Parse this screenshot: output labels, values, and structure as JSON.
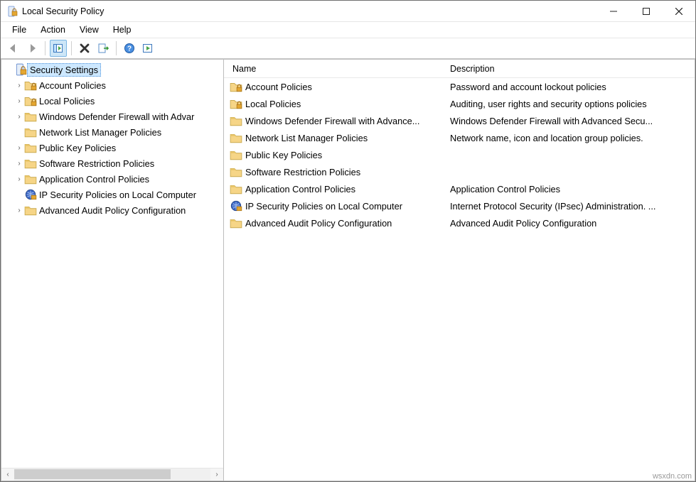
{
  "window": {
    "title": "Local Security Policy"
  },
  "menu": {
    "file": "File",
    "action": "Action",
    "view": "View",
    "help": "Help"
  },
  "tree": {
    "root": "Security Settings",
    "items": [
      {
        "label": "Account Policies",
        "icon": "folder-lock",
        "expandable": true
      },
      {
        "label": "Local Policies",
        "icon": "folder-lock",
        "expandable": true
      },
      {
        "label": "Windows Defender Firewall with Advar",
        "icon": "folder",
        "expandable": true
      },
      {
        "label": "Network List Manager Policies",
        "icon": "folder",
        "expandable": false
      },
      {
        "label": "Public Key Policies",
        "icon": "folder",
        "expandable": true
      },
      {
        "label": "Software Restriction Policies",
        "icon": "folder",
        "expandable": true
      },
      {
        "label": "Application Control Policies",
        "icon": "folder",
        "expandable": true
      },
      {
        "label": "IP Security Policies on Local Computer",
        "icon": "ipsec",
        "expandable": false
      },
      {
        "label": "Advanced Audit Policy Configuration",
        "icon": "folder",
        "expandable": true
      }
    ]
  },
  "columns": {
    "name": "Name",
    "description": "Description"
  },
  "list": [
    {
      "name": "Account Policies",
      "desc": "Password and account lockout policies",
      "icon": "folder-lock"
    },
    {
      "name": "Local Policies",
      "desc": "Auditing, user rights and security options policies",
      "icon": "folder-lock"
    },
    {
      "name": "Windows Defender Firewall with Advance...",
      "desc": "Windows Defender Firewall with Advanced Secu...",
      "icon": "folder"
    },
    {
      "name": "Network List Manager Policies",
      "desc": "Network name, icon and location group policies.",
      "icon": "folder"
    },
    {
      "name": "Public Key Policies",
      "desc": "",
      "icon": "folder"
    },
    {
      "name": "Software Restriction Policies",
      "desc": "",
      "icon": "folder"
    },
    {
      "name": "Application Control Policies",
      "desc": "Application Control Policies",
      "icon": "folder"
    },
    {
      "name": "IP Security Policies on Local Computer",
      "desc": "Internet Protocol Security (IPsec) Administration. ...",
      "icon": "ipsec"
    },
    {
      "name": "Advanced Audit Policy Configuration",
      "desc": "Advanced Audit Policy Configuration",
      "icon": "folder"
    }
  ],
  "watermark": "wsxdn.com"
}
